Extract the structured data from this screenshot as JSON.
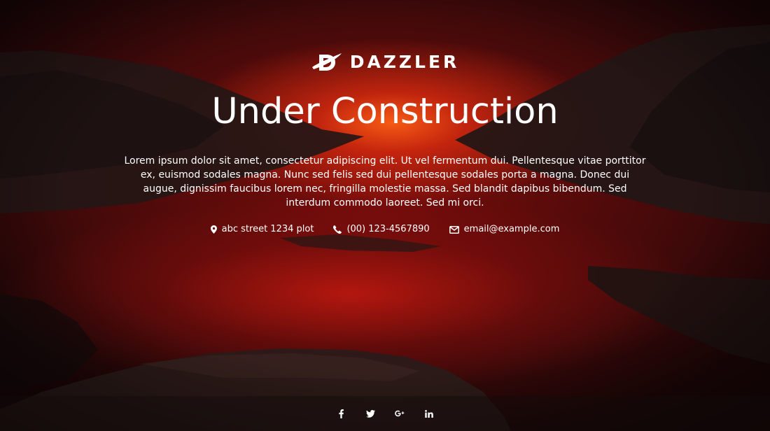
{
  "brand": {
    "name": "DAZZLER",
    "logo_icon": "dazzler-planet-d-icon"
  },
  "hero": {
    "title": "Under Construction",
    "description": "Lorem ipsum dolor sit amet, consectetur adipiscing elit. Ut vel fermentum dui. Pellentesque vitae porttitor ex, euismod sodales magna. Nunc sed felis sed dui pellentesque sodales porta a magna. Donec dui augue, dignissim faucibus lorem nec, fringilla molestie massa. Sed blandit dapibus bibendum. Sed interdum commodo laoreet. Sed mi orci."
  },
  "contact": {
    "address": "abc street 1234 plot",
    "phone": "(00) 123-4567890",
    "email": "email@example.com",
    "address_icon": "map-marker-icon",
    "phone_icon": "phone-icon",
    "email_icon": "envelope-icon"
  },
  "social": [
    {
      "network": "facebook",
      "icon": "facebook-icon"
    },
    {
      "network": "twitter",
      "icon": "twitter-icon"
    },
    {
      "network": "google-plus",
      "icon": "google-plus-icon"
    },
    {
      "network": "linkedin",
      "icon": "linkedin-icon"
    }
  ],
  "colors": {
    "glow": "#ff5f14",
    "deep_red": "#7a0d0b",
    "text": "#ffffff"
  }
}
